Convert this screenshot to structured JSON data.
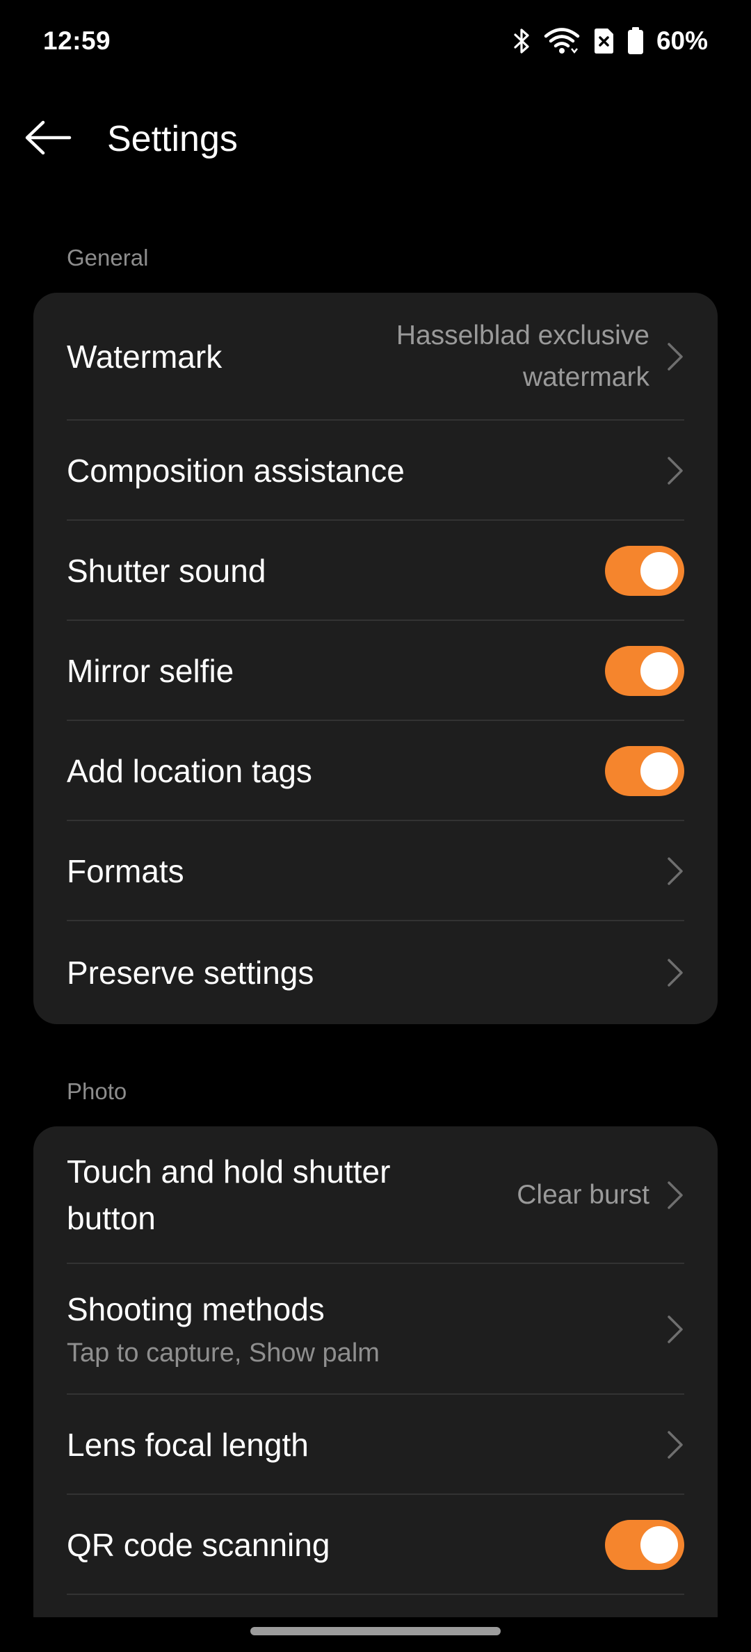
{
  "status_bar": {
    "time": "12:59",
    "battery": "60%",
    "icons": [
      "bluetooth-icon",
      "wifi-icon",
      "no-sim-icon",
      "battery-icon"
    ]
  },
  "app_bar": {
    "back_icon": "arrow-left-icon",
    "title": "Settings"
  },
  "general": {
    "label": "General",
    "watermark": {
      "title": "Watermark",
      "value_line1": "Hasselblad exclusive",
      "value_line2": "watermark"
    },
    "composition": {
      "title": "Composition assistance"
    },
    "shutter_sound": {
      "title": "Shutter sound",
      "on": true
    },
    "mirror_selfie": {
      "title": "Mirror selfie",
      "on": true
    },
    "location_tags": {
      "title": "Add location tags",
      "on": true
    },
    "formats": {
      "title": "Formats"
    },
    "preserve": {
      "title": "Preserve settings"
    }
  },
  "photo": {
    "label": "Photo",
    "touch_hold": {
      "title_line1": "Touch and hold shutter",
      "title_line2": "button",
      "value": "Clear burst"
    },
    "shooting_methods": {
      "title": "Shooting methods",
      "subtitle": "Tap to capture, Show palm"
    },
    "lens_focal": {
      "title": "Lens focal length"
    },
    "qr_scanning": {
      "title": "QR code scanning",
      "on": true
    }
  },
  "colors": {
    "accent": "#f5852d",
    "card": "#1e1e1e",
    "background": "#000000",
    "secondary_text": "#8d8d8d"
  }
}
